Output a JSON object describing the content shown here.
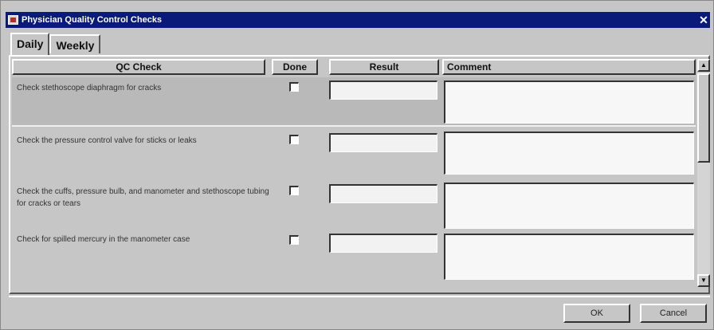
{
  "window": {
    "title": "Physician Quality Control Checks",
    "close_glyph": "✕",
    "title_color": "#0a1a78",
    "app_icon": "app-icon"
  },
  "tabs": [
    {
      "label": "Daily",
      "active": true
    },
    {
      "label": "Weekly",
      "active": false
    }
  ],
  "columns": {
    "qc_check": "QC Check",
    "done": "Done",
    "result": "Result",
    "comment": "Comment"
  },
  "rows": [
    {
      "check": "Check stethoscope diaphragm for cracks",
      "done": false,
      "result": "",
      "comment": ""
    },
    {
      "check": "Check the pressure control valve for sticks or leaks",
      "done": false,
      "result": "",
      "comment": ""
    },
    {
      "check": "Check the cuffs, pressure bulb, and manometer and stethoscope tubing for cracks or tears",
      "done": false,
      "result": "",
      "comment": ""
    },
    {
      "check": "Check for spilled mercury in the manometer case",
      "done": false,
      "result": "",
      "comment": ""
    }
  ],
  "scrollbar": {
    "up_glyph": "▲",
    "down_glyph": "▼"
  },
  "buttons": {
    "ok": "OK",
    "cancel": "Cancel"
  }
}
